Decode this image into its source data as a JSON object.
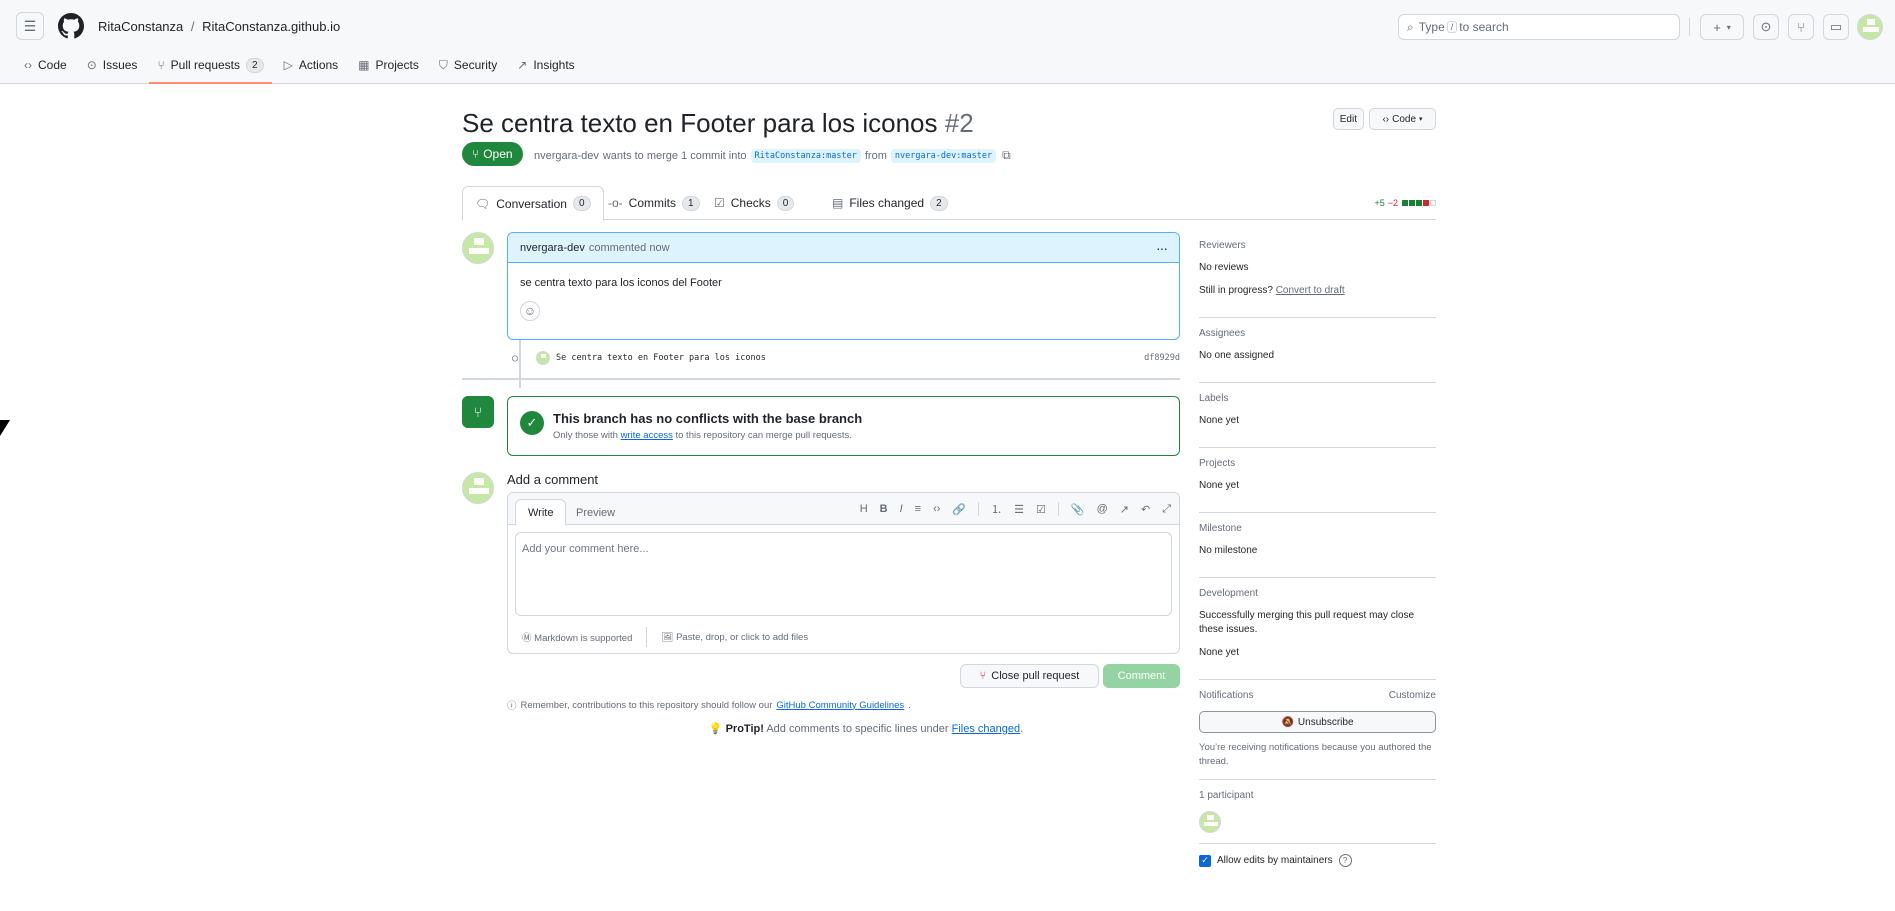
{
  "repo": {
    "owner": "RitaConstanza",
    "name": "RitaConstanza.github.io",
    "separator": "/"
  },
  "search": {
    "prefix": "Type",
    "key": "/",
    "suffix": "to search"
  },
  "nav": [
    {
      "label": "Code",
      "icon": "code-icon"
    },
    {
      "label": "Issues",
      "icon": "issue-icon"
    },
    {
      "label": "Pull requests",
      "icon": "pull-request-icon",
      "count": "2"
    },
    {
      "label": "Actions",
      "icon": "play-icon"
    },
    {
      "label": "Projects",
      "icon": "table-icon"
    },
    {
      "label": "Security",
      "icon": "shield-icon"
    },
    {
      "label": "Insights",
      "icon": "graph-icon"
    }
  ],
  "pr": {
    "title": "Se centra texto en Footer para los iconos",
    "number": "#2",
    "edit_label": "Edit",
    "code_label": "Code",
    "state": "Open",
    "author": "nvergara-dev",
    "merge_text": "wants to merge 1 commit into",
    "base": "RitaConstanza:master",
    "from": "from",
    "head": "nvergara-dev:master"
  },
  "tabs": [
    {
      "label": "Conversation",
      "count": "0"
    },
    {
      "label": "Commits",
      "count": "1"
    },
    {
      "label": "Checks",
      "count": "0"
    },
    {
      "label": "Files changed",
      "count": "2"
    }
  ],
  "diffstat": {
    "add": "+5",
    "del": "−2",
    "colors": [
      "#1a7f37",
      "#1a7f37",
      "#1a7f37",
      "#d1242f",
      "#ffffff"
    ]
  },
  "comment": {
    "author": "nvergara-dev",
    "when": "commented now",
    "body": "se centra texto para los iconos del Footer"
  },
  "commit": {
    "message": "Se centra texto en Footer para los iconos",
    "sha": "df8929d"
  },
  "merge": {
    "title": "This branch has no conflicts with the base branch",
    "sub_prefix": "Only those with",
    "sub_link": "write access",
    "sub_suffix": "to this repository can merge pull requests."
  },
  "add_comment": {
    "heading": "Add a comment",
    "write": "Write",
    "preview": "Preview",
    "placeholder": "Add your comment here...",
    "markdown": "Markdown is supported",
    "attach": "Paste, drop, or click to add files",
    "close_label": "Close pull request",
    "comment_label": "Comment",
    "remember_prefix": "Remember, contributions to this repository should follow our",
    "remember_link": "GitHub Community Guidelines",
    "protip_bold": "ProTip!",
    "protip_text": "Add comments to specific lines under",
    "protip_link": "Files changed"
  },
  "sidebar": {
    "reviewers": {
      "title": "Reviewers",
      "value": "No reviews",
      "progress": "Still in progress?",
      "convert": "Convert to draft"
    },
    "assignees": {
      "title": "Assignees",
      "value": "No one assigned"
    },
    "labels": {
      "title": "Labels",
      "value": "None yet"
    },
    "projects": {
      "title": "Projects",
      "value": "None yet"
    },
    "milestone": {
      "title": "Milestone",
      "value": "No milestone"
    },
    "development": {
      "title": "Development",
      "desc": "Successfully merging this pull request may close these issues.",
      "value": "None yet"
    },
    "notifications": {
      "title": "Notifications",
      "customize": "Customize",
      "unsubscribe": "Unsubscribe",
      "reason": "You’re receiving notifications because you authored the thread."
    },
    "participants": {
      "title": "1 participant"
    },
    "allow": {
      "label": "Allow edits by maintainers",
      "checked": true
    }
  }
}
